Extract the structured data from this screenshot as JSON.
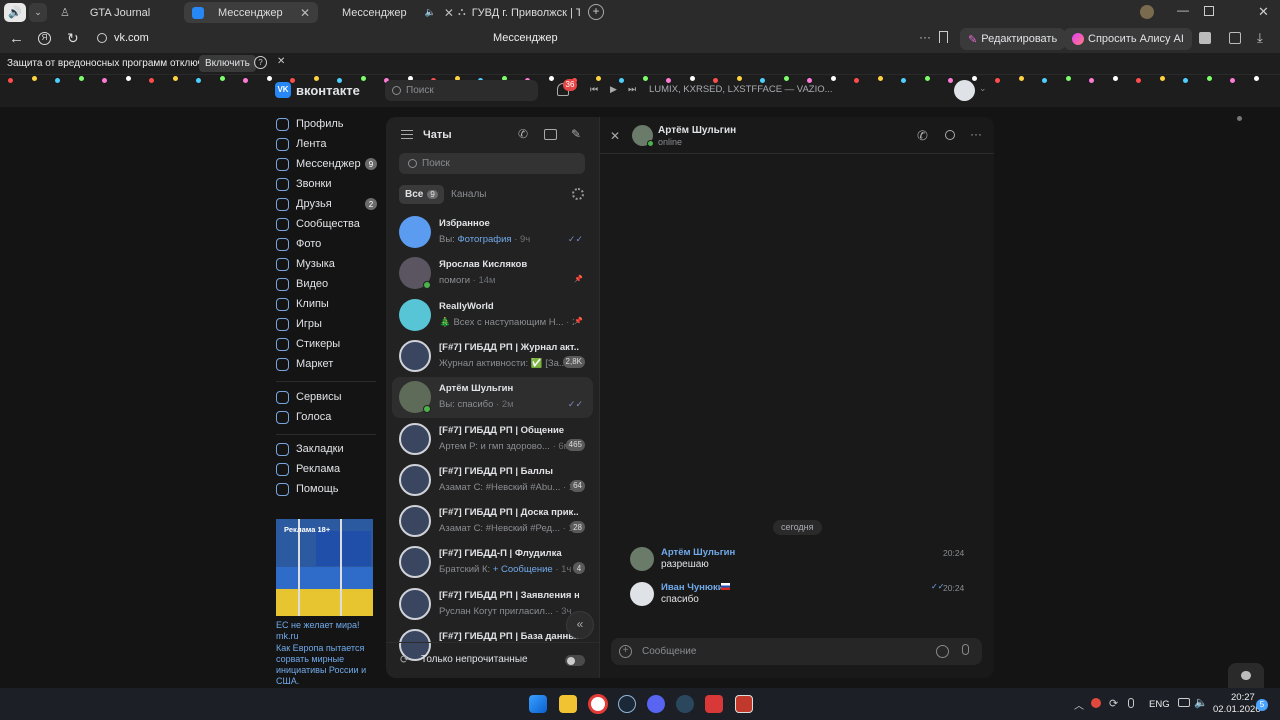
{
  "browser": {
    "tabs": [
      {
        "label": "GTA Journal"
      },
      {
        "label": "Мессенджер"
      },
      {
        "label": "Мессенджер"
      },
      {
        "label": "ГУВД г. Приволжск | Тру"
      }
    ],
    "url": "vk.com",
    "page_title": "Мессенджер",
    "edit_label": "Редактировать",
    "alice_label": "Спросить Алису AI",
    "warning_text": "Защита от вредоносных программ отключена",
    "enable_label": "Включить"
  },
  "vk": {
    "logo_text": "вконтакте",
    "search_placeholder": "Поиск",
    "notifications_count": "36",
    "player_track": "LUMIX, KXRSED, LXSTFFACE — VAZIO..."
  },
  "nav": {
    "items": [
      {
        "label": "Профиль"
      },
      {
        "label": "Лента"
      },
      {
        "label": "Мессенджер",
        "badge": "9"
      },
      {
        "label": "Звонки"
      },
      {
        "label": "Друзья",
        "badge": "2"
      },
      {
        "label": "Сообщества"
      },
      {
        "label": "Фото"
      },
      {
        "label": "Музыка"
      },
      {
        "label": "Видео"
      },
      {
        "label": "Клипы"
      },
      {
        "label": "Игры"
      },
      {
        "label": "Стикеры"
      },
      {
        "label": "Маркет"
      }
    ],
    "items2": [
      {
        "label": "Сервисы"
      },
      {
        "label": "Голоса"
      }
    ],
    "items3": [
      {
        "label": "Закладки"
      },
      {
        "label": "Реклама"
      },
      {
        "label": "Помощь"
      }
    ]
  },
  "ad": {
    "label": "Реклама 18+",
    "title": "ЕС не желает мира!",
    "source": "mk.ru",
    "text": "Как Европа пытается сорвать мирные инициативы России и США."
  },
  "chats": {
    "title": "Чаты",
    "search_placeholder": "Поиск",
    "filter_all": "Все",
    "filter_all_count": "9",
    "filter_channels": "Каналы",
    "unread_only": "Только непрочитанные",
    "items": [
      {
        "name": "Избранное",
        "prefix": "Вы: ",
        "link": "Фотография",
        "time": " · 9ч"
      },
      {
        "name": "Ярослав Кисляков",
        "preview": "помоги",
        "time": " · 14м"
      },
      {
        "name": "ReallyWorld",
        "preview": "🎄 Всех с наступающим Н...",
        "time": " · 2д"
      },
      {
        "name": "[F#7] ГИБДД РП | Журнал акт...",
        "preview": "Журнал активности: ✅ [За...",
        "badge": "2,8K"
      },
      {
        "name": "Артём Шульгин",
        "preview": "Вы: спасибо",
        "time": " · 2м"
      },
      {
        "name": "[F#7] ГИБДД РП | Общение",
        "preview": "Артем Р: и гмп здорово...",
        "time": " · 6м",
        "badge": "465"
      },
      {
        "name": "[F#7] ГИБДД РП | Баллы",
        "preview": "Азамат С: #Невский #Abu...",
        "time": " · 1ч",
        "badge": "64"
      },
      {
        "name": "[F#7] ГИБДД РП | Доска прик...",
        "preview": "Азамат С: #Невский #Ред...",
        "time": " · 1ч",
        "badge": "28"
      },
      {
        "name": "[F#7] ГИБДД-П | Флудилка",
        "prefix": "Братский К: ",
        "link": "+ Сообщение",
        "time": " · 1ч",
        "badge": "4"
      },
      {
        "name": "[F#7] ГИБДД РП | Заявления н...",
        "preview": "Руслан Когут пригласил...",
        "time": " · 3ч"
      },
      {
        "name": "[F#7] ГИБДД РП | База данны...",
        "preview": ""
      }
    ]
  },
  "conversation": {
    "name": "Артём Шульгин",
    "status": "online",
    "date_label": "сегодня",
    "input_placeholder": "Сообщение",
    "messages": [
      {
        "author": "Артём Шульгин",
        "text": "разрешаю",
        "time": "20:24"
      },
      {
        "author": "Иван Чунюкин",
        "text": "спасибо",
        "time": "20:24"
      }
    ]
  },
  "taskbar": {
    "lang": "ENG",
    "time": "20:27",
    "date": "02.01.2026",
    "notif_count": "5"
  }
}
